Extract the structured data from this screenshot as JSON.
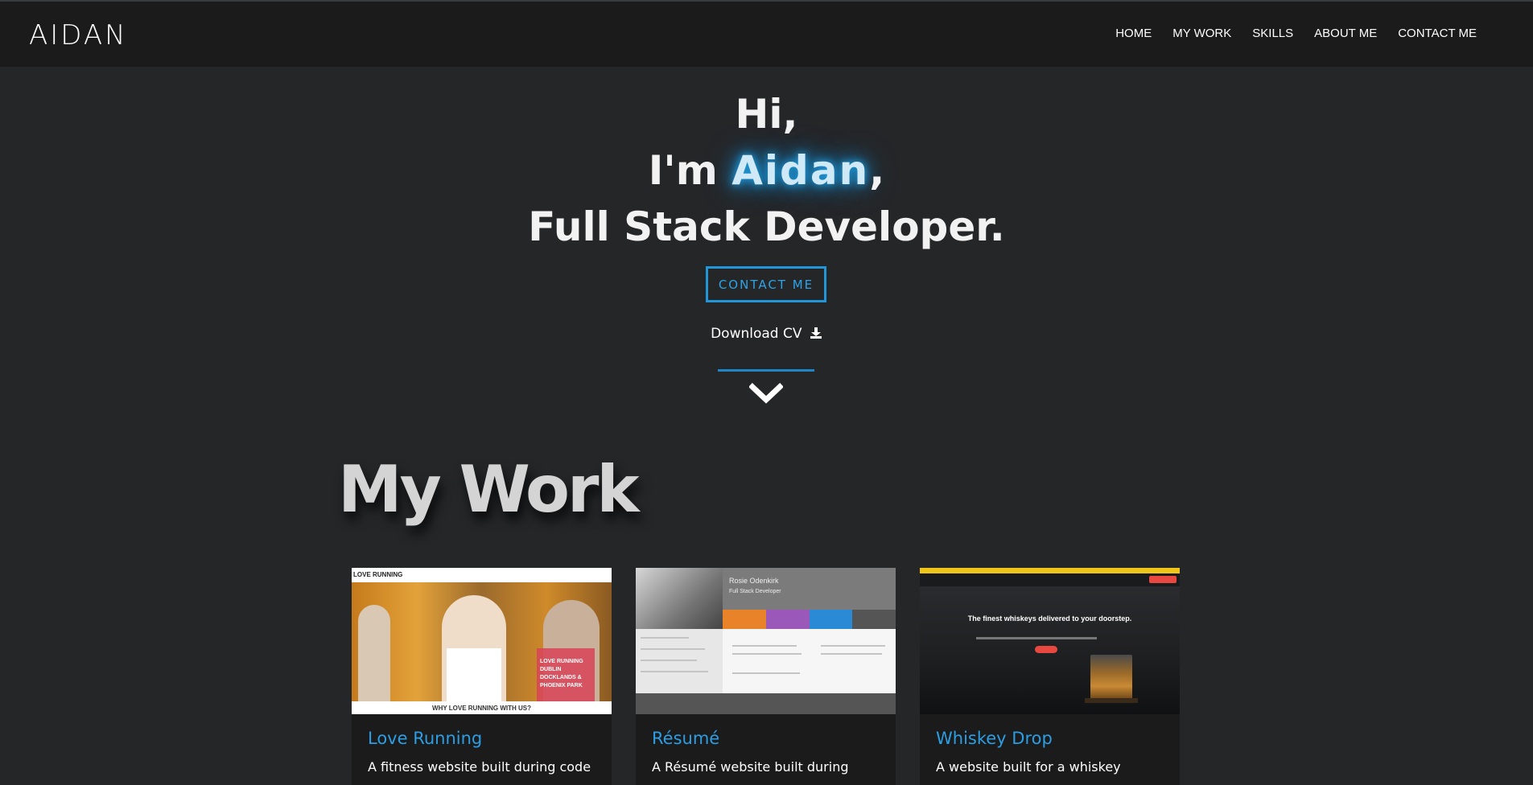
{
  "nav": {
    "brand": "AIDAN",
    "links": [
      "HOME",
      "MY WORK",
      "SKILLS",
      "ABOUT ME",
      "CONTACT ME"
    ]
  },
  "hero": {
    "line1": "Hi,",
    "line2_prefix": "I'm ",
    "line2_name": "Aidan",
    "line2_suffix": ",",
    "line3": "Full Stack Developer.",
    "contact_button": "CONTACT ME",
    "download_cv": "Download CV",
    "download_icon": "download-icon",
    "scroll_icon": "chevron-down-icon"
  },
  "my_work": {
    "title": "My Work",
    "projects": [
      {
        "title": "Love Running",
        "description": "A fitness website built during code",
        "thumb_logo": "LOVE RUNNING",
        "thumb_promo": "LOVE RUNNING DUBLIN DOCKLANDS & PHOENIX PARK",
        "thumb_footer": "WHY LOVE RUNNING WITH US?"
      },
      {
        "title": "Résumé",
        "description": "A Résumé website built during",
        "thumb_name": "Rosie Odenkirk",
        "thumb_role": "Full Stack Developer"
      },
      {
        "title": "Whiskey Drop",
        "description": "A website built for a whiskey",
        "thumb_headline": "The finest whiskeys delivered to your doorstep."
      }
    ]
  },
  "colors": {
    "background": "#252628",
    "navbar": "#1b1b1c",
    "accent": "#2196d9",
    "glow": "#1ea0e6"
  }
}
